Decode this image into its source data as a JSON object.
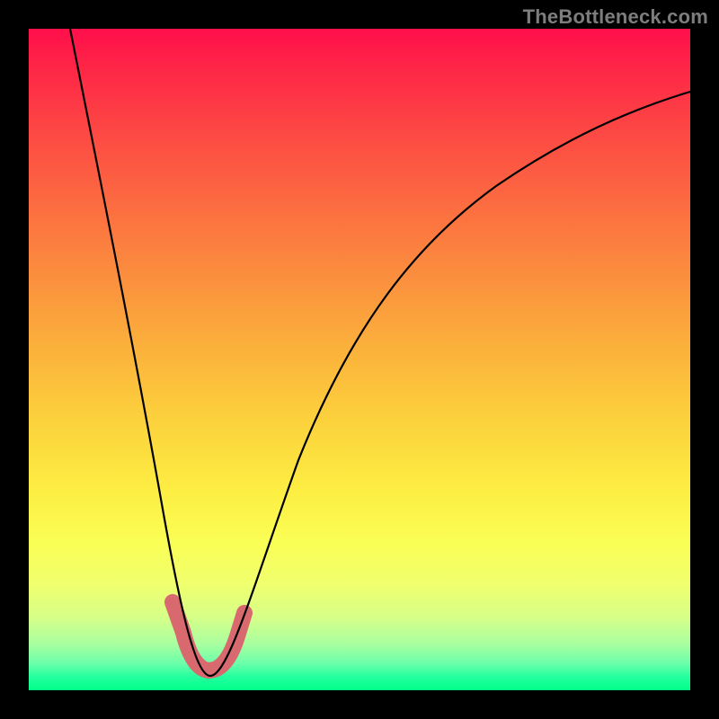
{
  "watermark": "TheBottleneck.com",
  "colors": {
    "page_bg": "#000000",
    "gradient_top": "#ff0f4a",
    "gradient_mid": "#fbb03b",
    "gradient_low": "#fdee43",
    "gradient_bottom": "#00ff8a",
    "curve": "#000000",
    "highlight": "#d86a6f"
  },
  "chart_data": {
    "type": "line",
    "title": "",
    "xlabel": "",
    "ylabel": "",
    "xlim": [
      0,
      100
    ],
    "ylim": [
      0,
      100
    ],
    "grid": false,
    "legend": false,
    "series": [
      {
        "name": "bottleneck-curve",
        "x": [
          6,
          8,
          10,
          12,
          14,
          16,
          18,
          20,
          22,
          24,
          25,
          26,
          27,
          28,
          29,
          30,
          32,
          34,
          36,
          38,
          40,
          44,
          48,
          52,
          56,
          60,
          66,
          72,
          80,
          90,
          100
        ],
        "y": [
          100,
          88,
          77,
          66,
          56,
          47,
          38,
          30,
          22,
          15,
          12,
          9,
          7,
          5,
          4,
          4,
          5,
          8,
          12,
          17,
          22,
          31,
          39,
          46,
          52,
          57,
          63,
          68,
          73,
          78,
          82
        ]
      }
    ],
    "annotations": [
      {
        "name": "optimal-range",
        "shape": "u",
        "x_range": [
          23,
          31
        ],
        "y_value": 5,
        "color": "#d86a6f"
      }
    ]
  }
}
